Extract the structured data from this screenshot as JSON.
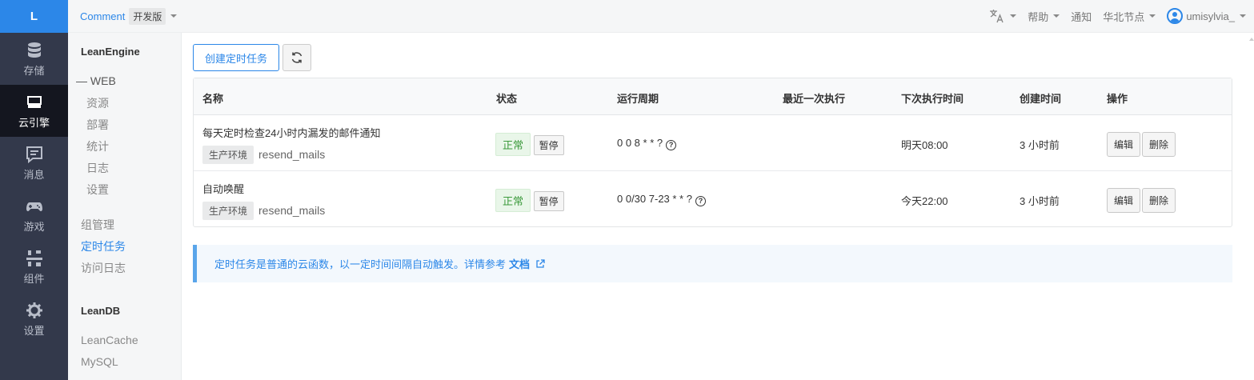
{
  "rail": {
    "logo": "L",
    "items": [
      {
        "label": "存储",
        "icon": "database-icon"
      },
      {
        "label": "云引擎",
        "icon": "engine-icon",
        "active": true
      },
      {
        "label": "消息",
        "icon": "message-icon"
      },
      {
        "label": "游戏",
        "icon": "gamepad-icon"
      },
      {
        "label": "组件",
        "icon": "components-icon"
      },
      {
        "label": "设置",
        "icon": "gear-icon"
      }
    ]
  },
  "topbar": {
    "app_name": "Comment",
    "env": "开发版",
    "help": "帮助",
    "notify": "通知",
    "region": "华北节点",
    "user": "umisylvia_"
  },
  "subnav": {
    "engine_header": "LeanEngine",
    "web": "WEB",
    "web_items": [
      "资源",
      "部署",
      "统计",
      "日志",
      "设置"
    ],
    "group_mgmt": "组管理",
    "cron": "定时任务",
    "access_log": "访问日志",
    "db_header": "LeanDB",
    "db_items": [
      "LeanCache",
      "MySQL"
    ]
  },
  "main": {
    "create_button": "创建定时任务",
    "columns": [
      "名称",
      "状态",
      "运行周期",
      "最近一次执行",
      "下次执行时间",
      "创建时间",
      "操作"
    ],
    "rows": [
      {
        "name": "每天定时检查24小时内漏发的邮件通知",
        "env": "生产环境",
        "function": "resend_mails",
        "status": "正常",
        "pause": "暂停",
        "cron": "0 0 8 * * ?",
        "last_run": "",
        "next_run": "明天08:00",
        "created": "3 小时前",
        "edit": "编辑",
        "delete": "删除"
      },
      {
        "name": "自动唤醒",
        "env": "生产环境",
        "function": "resend_mails",
        "status": "正常",
        "pause": "暂停",
        "cron": "0 0/30 7-23 * * ?",
        "last_run": "",
        "next_run": "今天22:00",
        "created": "3 小时前",
        "edit": "编辑",
        "delete": "删除"
      }
    ],
    "info_text": "定时任务是普通的云函数，以一定时间间隔自动触发。详情参考",
    "info_link": "文档"
  },
  "colors": {
    "accent": "#2c87e8",
    "rail_bg": "#33394b",
    "status_ok": "#3c9a3c"
  }
}
